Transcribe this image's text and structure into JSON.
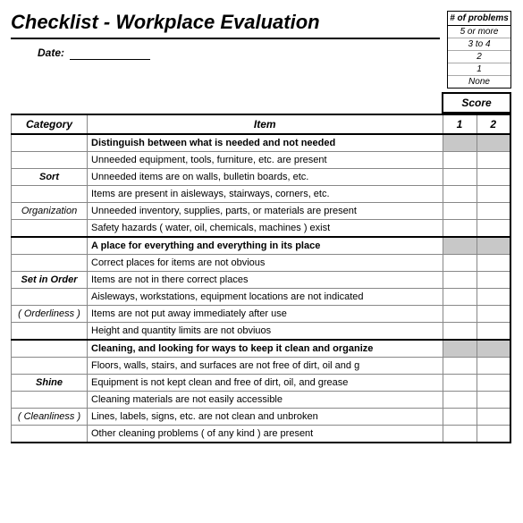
{
  "title": "Checklist - Workplace Evaluation",
  "date_label": "Date:",
  "legend": {
    "head": "# of problems",
    "rows": [
      "5 or more",
      "3 to 4",
      "2",
      "1",
      "None"
    ]
  },
  "score_label": "Score",
  "headers": {
    "category": "Category",
    "item": "Item",
    "s1": "1",
    "s2": "2"
  },
  "sections": [
    {
      "cat_main": "Sort",
      "cat_sub": "Organization",
      "head": "Distinguish between what is needed and not needed",
      "items": [
        "Unneeded equipment, tools, furniture, etc. are present",
        "Unneeded items are on walls, bulletin boards, etc.",
        "Items are present in aisleways, stairways, corners, etc.",
        "Unneeded inventory, supplies, parts, or materials are present",
        "Safety hazards ( water, oil, chemicals, machines ) exist"
      ]
    },
    {
      "cat_main": "Set in Order",
      "cat_sub": "( Orderliness )",
      "head": "A place for everything and everything in its place",
      "items": [
        "Correct places for items are not obvious",
        "Items are not in there correct places",
        "Aisleways, workstations, equipment locations are not indicated",
        "Items are not put away immediately after use",
        "Height and quantity limits are not obviuos"
      ]
    },
    {
      "cat_main": "Shine",
      "cat_sub": "( Cleanliness )",
      "head": "Cleaning, and looking for ways to keep it clean and organize",
      "items": [
        "Floors, walls, stairs, and surfaces are not free of dirt, oil and g",
        "Equipment is not kept clean and free of dirt, oil, and grease",
        "Cleaning materials are not easily accessible",
        "Lines, labels, signs, etc. are not clean and unbroken",
        "Other cleaning problems ( of any kind ) are present"
      ]
    }
  ]
}
